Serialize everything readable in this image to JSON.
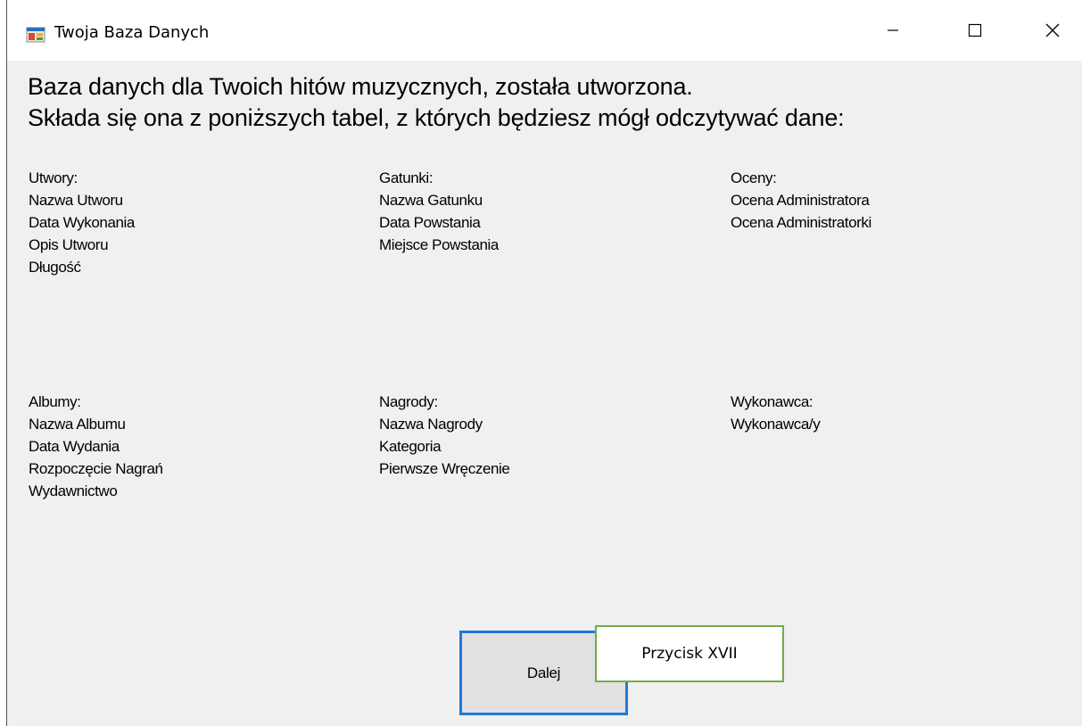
{
  "window": {
    "title": "Twoja Baza Danych",
    "icon": "app-window-icon",
    "controls": {
      "minimize": "minimize-icon",
      "maximize": "maximize-icon",
      "close": "close-icon"
    }
  },
  "heading": {
    "line1": "Baza danych dla Twoich hitów muzycznych, została utworzona.",
    "line2": "Składa się ona z poniższych tabel, z których będziesz mógł odczytywać dane:"
  },
  "tables": [
    {
      "title": "Utwory:",
      "fields": [
        "Nazwa Utworu",
        "Data Wykonania",
        "Opis Utworu",
        "Długość"
      ]
    },
    {
      "title": "Gatunki:",
      "fields": [
        "Nazwa Gatunku",
        "Data Powstania",
        "Miejsce Powstania"
      ]
    },
    {
      "title": "Oceny:",
      "fields": [
        "Ocena Administratora",
        "Ocena Administratorki"
      ]
    },
    {
      "title": "Albumy:",
      "fields": [
        "Nazwa Albumu",
        "Data Wydania",
        "Rozpoczęcie Nagrań",
        "Wydawnictwo"
      ]
    },
    {
      "title": "Nagrody:",
      "fields": [
        "Nazwa Nagrody",
        "Kategoria",
        "Pierwsze Wręczenie"
      ]
    },
    {
      "title": "Wykonawca:",
      "fields": [
        "Wykonawca/y"
      ]
    }
  ],
  "buttons": {
    "next_label": "Dalej"
  },
  "annotation": {
    "label": "Przycisk XVII",
    "border_color": "#70ad47"
  },
  "colors": {
    "background": "#f0f0f0",
    "button_focus_border": "#1e7ad6",
    "button_fill": "#e1e1e1"
  }
}
